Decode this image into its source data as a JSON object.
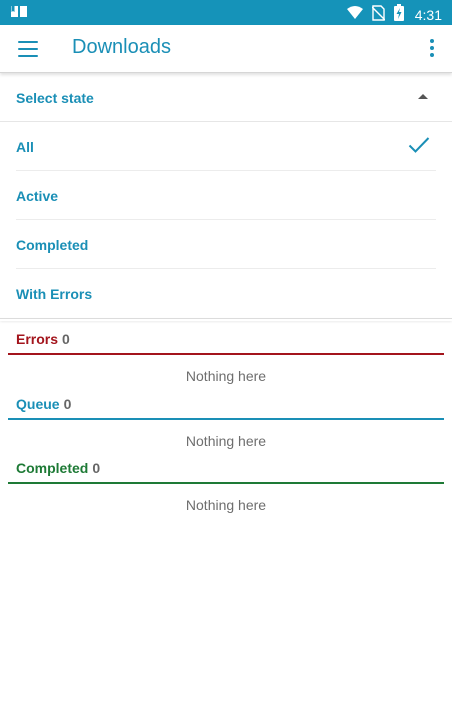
{
  "statusbar": {
    "time": "4:31",
    "icons": [
      "reader-icon",
      "wifi-icon",
      "no-sim-icon",
      "battery-charging-icon"
    ]
  },
  "appbar": {
    "title": "Downloads",
    "menu_icon": "hamburger-menu-icon",
    "overflow_icon": "more-vert-icon"
  },
  "state_selector": {
    "header_label": "Select state",
    "expanded": true,
    "options": [
      {
        "label": "All",
        "selected": true
      },
      {
        "label": "Active",
        "selected": false
      },
      {
        "label": "Completed",
        "selected": false
      },
      {
        "label": "With Errors",
        "selected": false
      }
    ]
  },
  "sections": {
    "errors": {
      "title": "Errors",
      "count": "0",
      "empty_text": "Nothing here",
      "color": "#a3141c"
    },
    "queue": {
      "title": "Queue",
      "count": "0",
      "empty_text": "Nothing here",
      "color": "#1a8fb6"
    },
    "completed": {
      "title": "Completed",
      "count": "0",
      "empty_text": "Nothing here",
      "color": "#1e7a36"
    }
  },
  "colors": {
    "primary": "#1593b9",
    "accent_text": "#1a8fb6"
  }
}
